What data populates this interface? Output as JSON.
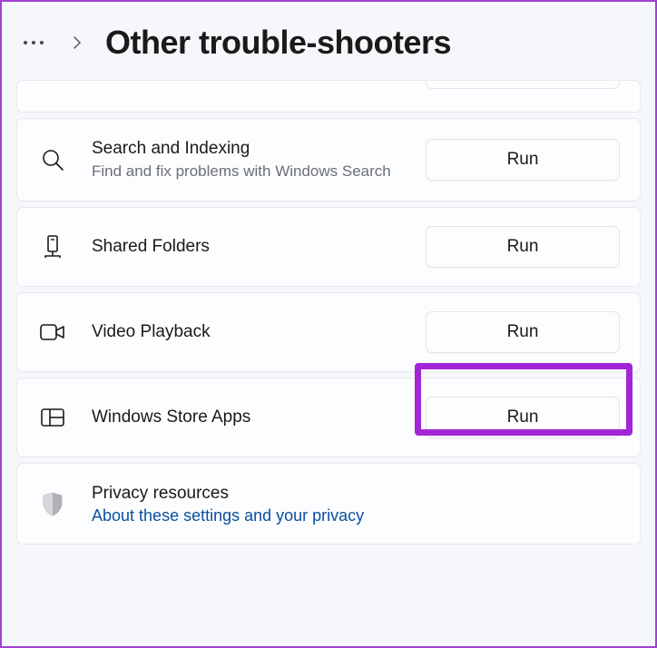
{
  "header": {
    "title": "Other trouble-shooters"
  },
  "items": {
    "search": {
      "title": "Search and Indexing",
      "subtitle": "Find and fix problems with Windows Search",
      "action": "Run"
    },
    "shared": {
      "title": "Shared Folders",
      "action": "Run"
    },
    "video": {
      "title": "Video Playback",
      "action": "Run"
    },
    "store": {
      "title": "Windows Store Apps",
      "action": "Run"
    }
  },
  "privacy": {
    "title": "Privacy resources",
    "link": "About these settings and your privacy"
  }
}
